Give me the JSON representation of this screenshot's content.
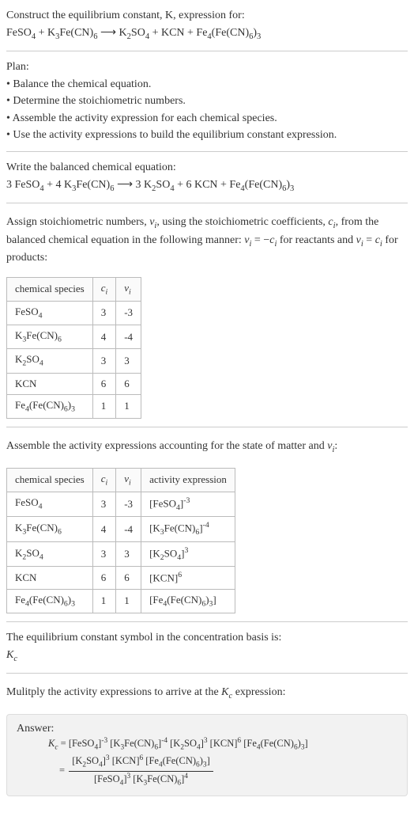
{
  "chart_data": {
    "type": "table",
    "title": "Stoichiometric numbers and activity expressions",
    "tables": [
      {
        "columns": [
          "chemical species",
          "c_i",
          "ν_i"
        ],
        "rows": [
          [
            "FeSO4",
            3,
            -3
          ],
          [
            "K3Fe(CN)6",
            4,
            -4
          ],
          [
            "K2SO4",
            3,
            3
          ],
          [
            "KCN",
            6,
            6
          ],
          [
            "Fe4(Fe(CN)6)3",
            1,
            1
          ]
        ]
      },
      {
        "columns": [
          "chemical species",
          "c_i",
          "ν_i",
          "activity expression"
        ],
        "rows": [
          [
            "FeSO4",
            3,
            -3,
            "[FeSO4]^-3"
          ],
          [
            "K3Fe(CN)6",
            4,
            -4,
            "[K3Fe(CN)6]^-4"
          ],
          [
            "K2SO4",
            3,
            3,
            "[K2SO4]^3"
          ],
          [
            "KCN",
            6,
            6,
            "[KCN]^6"
          ],
          [
            "Fe4(Fe(CN)6)3",
            1,
            1,
            "[Fe4(Fe(CN)6)3]"
          ]
        ]
      }
    ]
  },
  "header_line1": "Construct the equilibrium constant, K, expression for:",
  "header_eq_lhs1": "FeSO",
  "header_eq_lhs2": " + K",
  "header_eq_lhs3": "Fe(CN)",
  "header_eq_arrow": "  ⟶  ",
  "header_eq_rhs1": "K",
  "header_eq_rhs2": "SO",
  "header_eq_rhs3": " + KCN + Fe",
  "header_eq_rhs4": "(Fe(CN)",
  "header_eq_rhs5": ")",
  "plan_title": "Plan:",
  "plan_b1": "• Balance the chemical equation.",
  "plan_b2": "• Determine the stoichiometric numbers.",
  "plan_b3": "• Assemble the activity expression for each chemical species.",
  "plan_b4": "• Use the activity expressions to build the equilibrium constant expression.",
  "balanced_title": "Write the balanced chemical equation:",
  "bal_c1": "3 FeSO",
  "bal_c2": " + 4 K",
  "bal_c3": "Fe(CN)",
  "bal_c4": "3 K",
  "bal_c5": "SO",
  "bal_c6": " + 6 KCN + Fe",
  "bal_c7": "(Fe(CN)",
  "bal_c8": ")",
  "assign_text1": "Assign stoichiometric numbers, ",
  "assign_nu": "ν",
  "assign_i": "i",
  "assign_text2": ", using the stoichiometric coefficients, ",
  "assign_c": "c",
  "assign_text3": ", from the balanced chemical equation in the following manner: ",
  "assign_eq1": " = −",
  "assign_text4": " for reactants and ",
  "assign_eq2": " = ",
  "assign_text5": " for products:",
  "table1": {
    "h1": "chemical species",
    "h2": "c",
    "h3": "ν",
    "rows": [
      {
        "species": "FeSO",
        "sub": "4",
        "c": "3",
        "v": "-3"
      },
      {
        "species": "K",
        "s2": "3",
        "mid": "Fe(CN)",
        "s3": "6",
        "c": "4",
        "v": "-4"
      },
      {
        "species": "K",
        "s2": "2",
        "mid": "SO",
        "s3": "4",
        "c": "3",
        "v": "3"
      },
      {
        "species": "KCN",
        "c": "6",
        "v": "6"
      },
      {
        "species": "Fe",
        "s2": "4",
        "mid": "(Fe(CN)",
        "s3": "6",
        "tail": ")",
        "s4": "3",
        "c": "1",
        "v": "1"
      }
    ]
  },
  "assemble_text1": "Assemble the activity expressions accounting for the state of matter and ",
  "assemble_text2": ":",
  "table2": {
    "h1": "chemical species",
    "h2": "c",
    "h3": "ν",
    "h4": "activity expression",
    "rows": [
      {
        "c": "3",
        "v": "-3",
        "exp": "-3"
      },
      {
        "c": "4",
        "v": "-4",
        "exp": "-4"
      },
      {
        "c": "3",
        "v": "3",
        "exp": "3"
      },
      {
        "c": "6",
        "v": "6",
        "exp": "6"
      },
      {
        "c": "1",
        "v": "1"
      }
    ]
  },
  "eqconst_line1": "The equilibrium constant symbol in the concentration basis is:",
  "eqconst_Kc": "K",
  "multiply_line": "Mulitply the activity expressions to arrive at the ",
  "multiply_line2": " expression:",
  "answer_label": "Answer:",
  "eq_sign": " = ",
  "lbr": "[",
  "rbr": "]",
  "species": {
    "feso4_a": "FeSO",
    "feso4_b": "4",
    "k3fe_a": "K",
    "k3fe_b": "3",
    "k3fe_c": "Fe(CN)",
    "k3fe_d": "6",
    "k2so4_a": "K",
    "k2so4_b": "2",
    "k2so4_c": "SO",
    "k2so4_d": "4",
    "kcn": "KCN",
    "fe4_a": "Fe",
    "fe4_b": "4",
    "fe4_c": "(Fe(CN)",
    "fe4_d": "6",
    "fe4_e": ")",
    "fe4_f": "3"
  },
  "exp": {
    "m3": "-3",
    "m4": "-4",
    "p3": "3",
    "p4": "4",
    "p6": "6"
  },
  "n3": "3",
  "n4": "4",
  "n6": "6",
  "n2": "2",
  "nc": "c"
}
